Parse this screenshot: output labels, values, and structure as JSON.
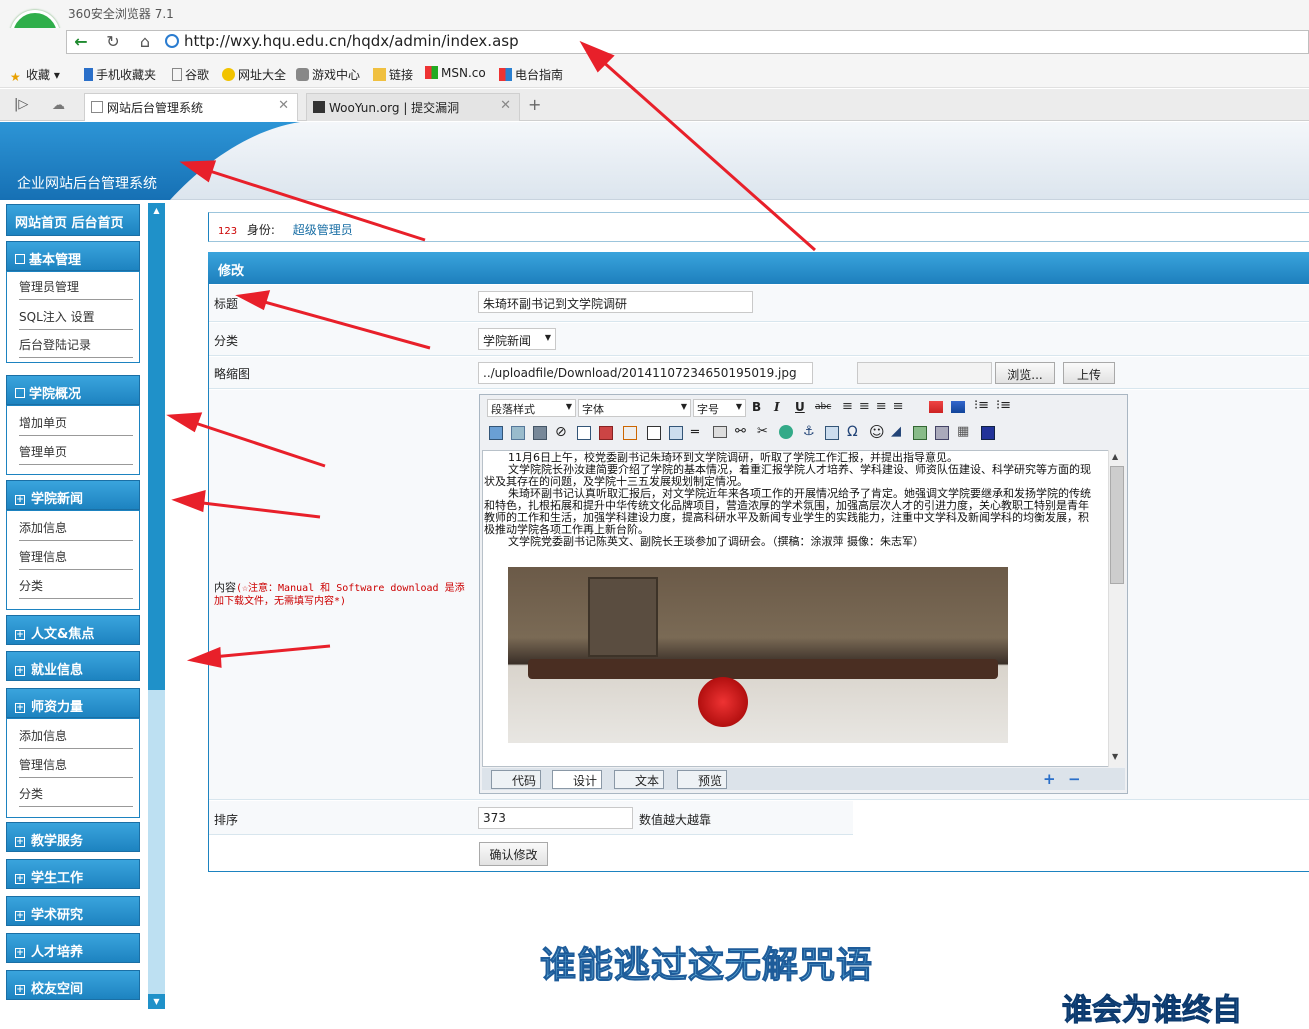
{
  "browser": {
    "app_name": "360安全浏览器 7.1",
    "url": "http://wxy.hqu.edu.cn/hqdx/admin/index.asp",
    "bookmarks": [
      "收藏",
      "手机收藏夹",
      "谷歌",
      "网址大全",
      "游戏中心",
      "链接",
      "MSN.co",
      "电台指南"
    ],
    "tabs": [
      {
        "label": "网站后台管理系统",
        "active": true
      },
      {
        "label": "WooYun.org | 提交漏洞",
        "active": false
      }
    ]
  },
  "header": {
    "system_name": "企业网站后台管理系统"
  },
  "sidebar": {
    "top_link": "网站首页  后台首页",
    "sections": [
      {
        "label": "基本管理",
        "items": [
          "管理员管理",
          "SQL注入 设置",
          "后台登陆记录"
        ]
      },
      {
        "label": "学院概况",
        "items": [
          "增加单页",
          "管理单页"
        ]
      },
      {
        "label": "学院新闻",
        "items": [
          "添加信息",
          "管理信息",
          "分类"
        ]
      },
      {
        "label": "人文&焦点",
        "items": []
      },
      {
        "label": "就业信息",
        "items": []
      },
      {
        "label": "师资力量",
        "items": [
          "添加信息",
          "管理信息",
          "分类"
        ]
      },
      {
        "label": "教学服务",
        "items": []
      },
      {
        "label": "学生工作",
        "items": []
      },
      {
        "label": "学术研究",
        "items": []
      },
      {
        "label": "人才培养",
        "items": []
      },
      {
        "label": "校友空间",
        "items": []
      }
    ]
  },
  "identity": {
    "id": "123",
    "label": "身份:",
    "role": "超级管理员"
  },
  "form": {
    "panel_title": "修改",
    "title_label": "标题",
    "title_value": "朱琦环副书记到文学院调研",
    "category_label": "分类",
    "category_value": "学院新闻",
    "thumb_label": "略缩图",
    "thumb_value": "../uploadfile/Download/20141107234650195019.jpg",
    "browse_button": "浏览...",
    "upload_button": "上传",
    "content_label": "内容",
    "content_note": "(☆注意：Manual 和 Software download 是添加下载文件，无需填写内容*)",
    "order_label": "排序",
    "order_value": "373",
    "order_hint": "数值越大越靠",
    "submit_button": "确认修改"
  },
  "editor": {
    "selects": [
      "段落样式",
      "字体",
      "字号"
    ],
    "paragraphs": [
      "11月6日上午，校党委副书记朱琦环到文学院调研，听取了学院工作汇报，并提出指导意见。",
      "文学院院长孙汝建简要介绍了学院的基本情况，着重汇报学院人才培养、学科建设、师资队伍建设、科学研究等方面的现状及其存在的问题，及学院十三五发展规划制定情况。",
      "朱琦环副书记认真听取汇报后，对文学院近年来各项工作的开展情况给予了肯定。她强调文学院要继承和发扬学院的传统和特色，扎根拓展和提升中华传统文化品牌项目，营造浓厚的学术氛围，加强高层次人才的引进力度，关心教职工特别是青年教师的工作和生活，加强学科建设力度，提高科研水平及新闻专业学生的实践能力，注重中文学科及新闻学科的均衡发展，积极推动学院各项工作再上新台阶。",
      "文学院党委副书记陈英文、副院长王琰参加了调研会。（撰稿：涂淑萍   摄像：朱志军）"
    ],
    "tabs": [
      "代码",
      "设计",
      "文本",
      "预览"
    ]
  },
  "overlay": {
    "caption": "谁能逃过这无解咒语",
    "caption2": "谁会为谁终自"
  }
}
